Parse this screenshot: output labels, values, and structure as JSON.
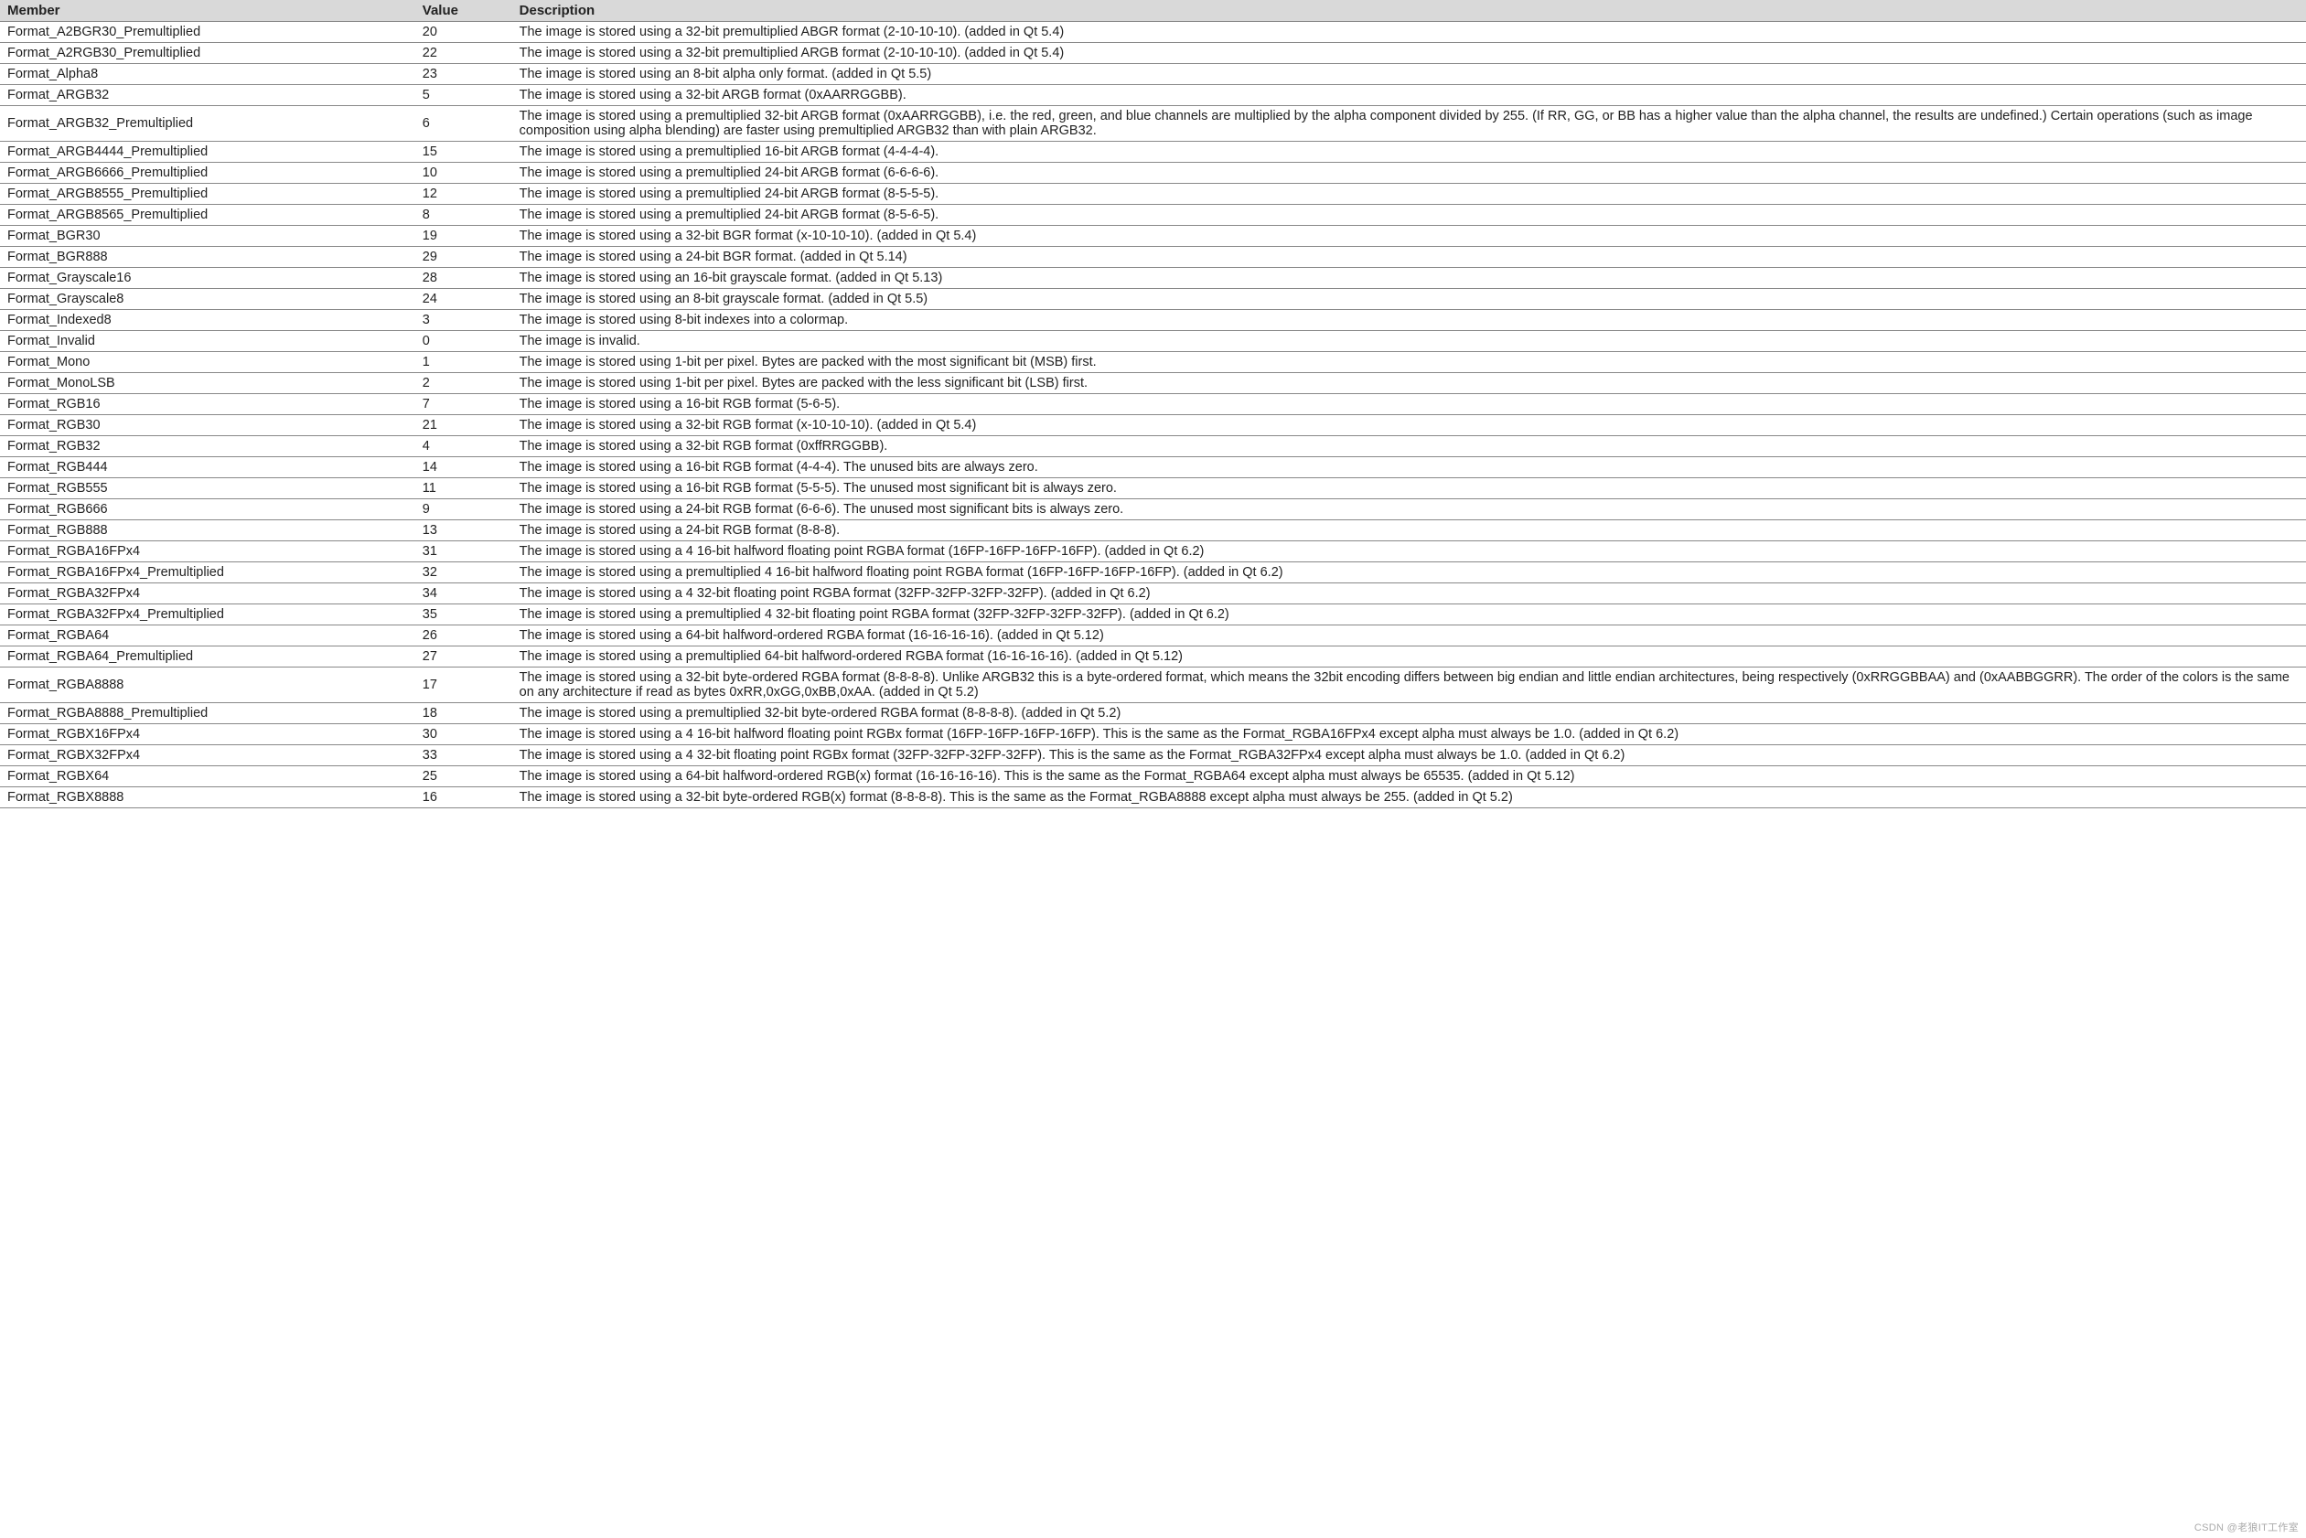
{
  "headers": {
    "member": "Member",
    "value": "Value",
    "desc": "Description"
  },
  "watermark": "CSDN @老狼IT工作室",
  "rows": [
    {
      "member": "Format_A2BGR30_Premultiplied",
      "value": "20",
      "desc": "The image is stored using a 32-bit premultiplied ABGR format (2-10-10-10). (added in Qt 5.4)"
    },
    {
      "member": "Format_A2RGB30_Premultiplied",
      "value": "22",
      "desc": "The image is stored using a 32-bit premultiplied ARGB format (2-10-10-10). (added in Qt 5.4)"
    },
    {
      "member": "Format_Alpha8",
      "value": "23",
      "desc": "The image is stored using an 8-bit alpha only format. (added in Qt 5.5)"
    },
    {
      "member": "Format_ARGB32",
      "value": "5",
      "desc": "The image is stored using a 32-bit ARGB format (0xAARRGGBB)."
    },
    {
      "member": "Format_ARGB32_Premultiplied",
      "value": "6",
      "desc": "The image is stored using a premultiplied 32-bit ARGB format (0xAARRGGBB), i.e. the red, green, and blue channels are multiplied by the alpha component divided by 255. (If RR, GG, or BB has a higher value than the alpha channel, the results are undefined.) Certain operations (such as image composition using alpha blending) are faster using premultiplied ARGB32 than with plain ARGB32."
    },
    {
      "member": "Format_ARGB4444_Premultiplied",
      "value": "15",
      "desc": "The image is stored using a premultiplied 16-bit ARGB format (4-4-4-4)."
    },
    {
      "member": "Format_ARGB6666_Premultiplied",
      "value": "10",
      "desc": "The image is stored using a premultiplied 24-bit ARGB format (6-6-6-6)."
    },
    {
      "member": "Format_ARGB8555_Premultiplied",
      "value": "12",
      "desc": "The image is stored using a premultiplied 24-bit ARGB format (8-5-5-5)."
    },
    {
      "member": "Format_ARGB8565_Premultiplied",
      "value": "8",
      "desc": "The image is stored using a premultiplied 24-bit ARGB format (8-5-6-5)."
    },
    {
      "member": "Format_BGR30",
      "value": "19",
      "desc": "The image is stored using a 32-bit BGR format (x-10-10-10). (added in Qt 5.4)"
    },
    {
      "member": "Format_BGR888",
      "value": "29",
      "desc": "The image is stored using a 24-bit BGR format. (added in Qt 5.14)"
    },
    {
      "member": "Format_Grayscale16",
      "value": "28",
      "desc": "The image is stored using an 16-bit grayscale format. (added in Qt 5.13)"
    },
    {
      "member": "Format_Grayscale8",
      "value": "24",
      "desc": "The image is stored using an 8-bit grayscale format. (added in Qt 5.5)"
    },
    {
      "member": "Format_Indexed8",
      "value": "3",
      "desc": "The image is stored using 8-bit indexes into a colormap."
    },
    {
      "member": "Format_Invalid",
      "value": "0",
      "desc": "The image is invalid."
    },
    {
      "member": "Format_Mono",
      "value": "1",
      "desc": "The image is stored using 1-bit per pixel. Bytes are packed with the most significant bit (MSB) first."
    },
    {
      "member": "Format_MonoLSB",
      "value": "2",
      "desc": "The image is stored using 1-bit per pixel. Bytes are packed with the less significant bit (LSB) first."
    },
    {
      "member": "Format_RGB16",
      "value": "7",
      "desc": "The image is stored using a 16-bit RGB format (5-6-5)."
    },
    {
      "member": "Format_RGB30",
      "value": "21",
      "desc": "The image is stored using a 32-bit RGB format (x-10-10-10). (added in Qt 5.4)"
    },
    {
      "member": "Format_RGB32",
      "value": "4",
      "desc": "The image is stored using a 32-bit RGB format (0xffRRGGBB)."
    },
    {
      "member": "Format_RGB444",
      "value": "14",
      "desc": "The image is stored using a 16-bit RGB format (4-4-4). The unused bits are always zero."
    },
    {
      "member": "Format_RGB555",
      "value": "11",
      "desc": "The image is stored using a 16-bit RGB format (5-5-5). The unused most significant bit is always zero."
    },
    {
      "member": "Format_RGB666",
      "value": "9",
      "desc": "The image is stored using a 24-bit RGB format (6-6-6). The unused most significant bits is always zero."
    },
    {
      "member": "Format_RGB888",
      "value": "13",
      "desc": "The image is stored using a 24-bit RGB format (8-8-8)."
    },
    {
      "member": "Format_RGBA16FPx4",
      "value": "31",
      "desc": "The image is stored using a 4 16-bit halfword floating point RGBA format (16FP-16FP-16FP-16FP). (added in Qt 6.2)"
    },
    {
      "member": "Format_RGBA16FPx4_Premultiplied",
      "value": "32",
      "desc": "The image is stored using a premultiplied 4 16-bit halfword floating point RGBA format (16FP-16FP-16FP-16FP). (added in Qt 6.2)"
    },
    {
      "member": "Format_RGBA32FPx4",
      "value": "34",
      "desc": "The image is stored using a 4 32-bit floating point RGBA format (32FP-32FP-32FP-32FP). (added in Qt 6.2)"
    },
    {
      "member": "Format_RGBA32FPx4_Premultiplied",
      "value": "35",
      "desc": "The image is stored using a premultiplied 4 32-bit floating point RGBA format (32FP-32FP-32FP-32FP). (added in Qt 6.2)"
    },
    {
      "member": "Format_RGBA64",
      "value": "26",
      "desc": "The image is stored using a 64-bit halfword-ordered RGBA format (16-16-16-16). (added in Qt 5.12)"
    },
    {
      "member": "Format_RGBA64_Premultiplied",
      "value": "27",
      "desc": "The image is stored using a premultiplied 64-bit halfword-ordered RGBA format (16-16-16-16). (added in Qt 5.12)"
    },
    {
      "member": "Format_RGBA8888",
      "value": "17",
      "desc": "The image is stored using a 32-bit byte-ordered RGBA format (8-8-8-8). Unlike ARGB32 this is a byte-ordered format, which means the 32bit encoding differs between big endian and little endian architectures, being respectively (0xRRGGBBAA) and (0xAABBGGRR). The order of the colors is the same on any architecture if read as bytes 0xRR,0xGG,0xBB,0xAA. (added in Qt 5.2)"
    },
    {
      "member": "Format_RGBA8888_Premultiplied",
      "value": "18",
      "desc": "The image is stored using a premultiplied 32-bit byte-ordered RGBA format (8-8-8-8). (added in Qt 5.2)"
    },
    {
      "member": "Format_RGBX16FPx4",
      "value": "30",
      "desc": "The image is stored using a 4 16-bit halfword floating point RGBx format (16FP-16FP-16FP-16FP). This is the same as the Format_RGBA16FPx4 except alpha must always be 1.0. (added in Qt 6.2)"
    },
    {
      "member": "Format_RGBX32FPx4",
      "value": "33",
      "desc": "The image is stored using a 4 32-bit floating point RGBx format (32FP-32FP-32FP-32FP). This is the same as the Format_RGBA32FPx4 except alpha must always be 1.0. (added in Qt 6.2)"
    },
    {
      "member": "Format_RGBX64",
      "value": "25",
      "desc": "The image is stored using a 64-bit halfword-ordered RGB(x) format (16-16-16-16). This is the same as the Format_RGBA64 except alpha must always be 65535. (added in Qt 5.12)"
    },
    {
      "member": "Format_RGBX8888",
      "value": "16",
      "desc": "The image is stored using a 32-bit byte-ordered RGB(x) format (8-8-8-8). This is the same as the Format_RGBA8888 except alpha must always be 255. (added in Qt 5.2)"
    }
  ]
}
